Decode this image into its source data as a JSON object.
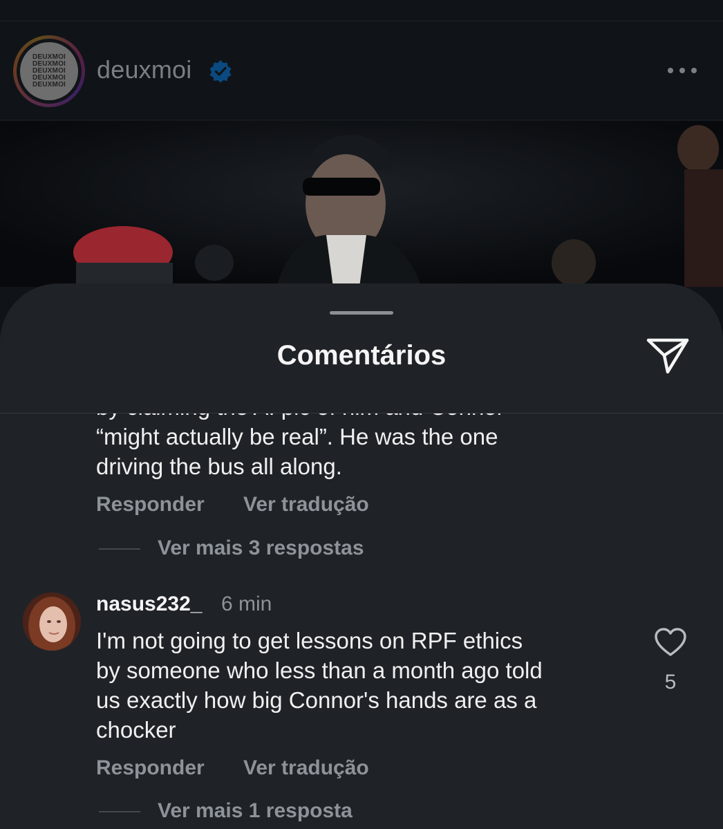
{
  "post": {
    "account_logo_text": [
      "DEUXMOI",
      "DEUXMOI",
      "DEUXMOI",
      "DEUXMOI",
      "DEUXMOI"
    ],
    "username": "deuxmoi",
    "verified_icon": "verified-badge-icon",
    "more_icon": "more-options-icon"
  },
  "sheet": {
    "title": "Comentários",
    "share_icon": "send-icon"
  },
  "comments": [
    {
      "text_lines": [
        "by claiming the AI pic of him and Connor",
        "“might actually be real”. He was the one",
        "driving the bus all along."
      ],
      "reply_label": "Responder",
      "translate_label": "Ver tradução",
      "more_replies": "Ver mais 3 respostas"
    },
    {
      "username": "nasus232_",
      "time": "6 min",
      "text_lines": [
        "I'm not going to get lessons on RPF ethics",
        "by someone who less than a month ago told",
        "us exactly how big Connor's hands are as a",
        "chocker"
      ],
      "likes": "5",
      "like_icon": "heart-icon",
      "reply_label": "Responder",
      "translate_label": "Ver tradução",
      "more_replies": "Ver mais 1 resposta"
    }
  ],
  "colors": {
    "background": "#0c1014",
    "sheet": "#1f2327",
    "text_primary": "#f5f5f5",
    "text_secondary": "#8e9399",
    "verified_blue": "#0095f6"
  }
}
